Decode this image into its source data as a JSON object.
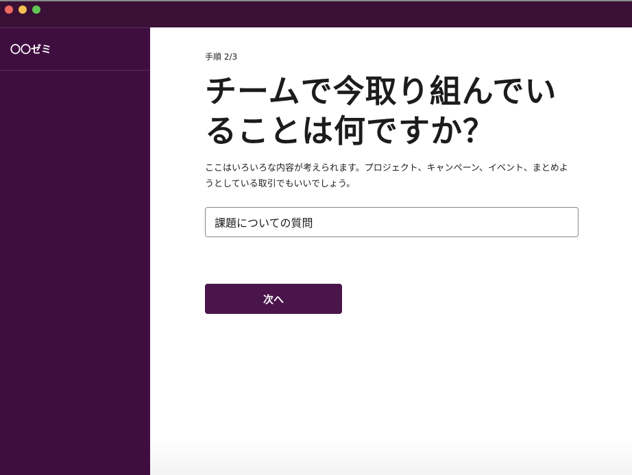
{
  "window": {
    "buttons": [
      "close",
      "minimize",
      "maximize"
    ],
    "titlebar_color": "#3a1036"
  },
  "sidebar": {
    "workspace_name": "〇〇ゼミ",
    "color": "#3f0e40"
  },
  "main": {
    "step_label": "手順 2/3",
    "heading": "チームで今取り組んでいることは何ですか？",
    "description": "ここはいろいろな内容が考えられます。プロジェクト、キャンペーン、イベント、まとめようとしている取引でもいいでしょう。",
    "input": {
      "value": "課題についての質問"
    },
    "next_button_label": "次へ",
    "accent_color": "#4a154b"
  }
}
